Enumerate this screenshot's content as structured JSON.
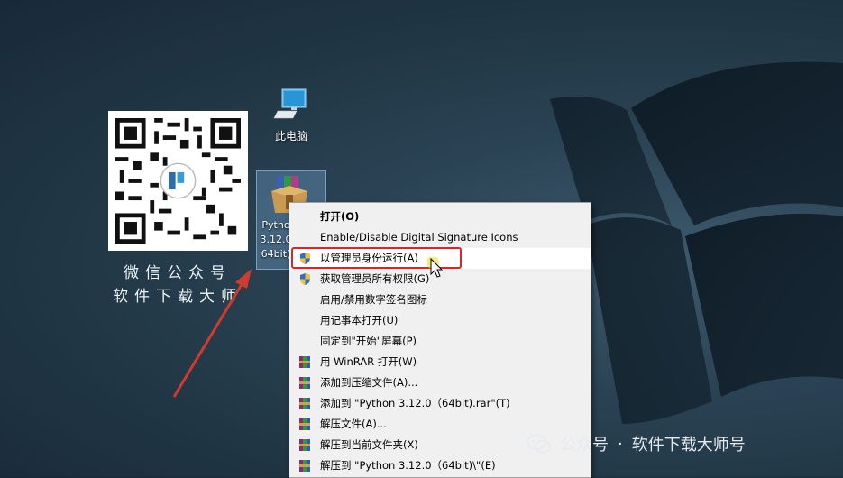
{
  "desktop": {
    "qr_caption_line1": "微信公众号",
    "qr_caption_line2": "软件下载大师",
    "this_pc_label": "此电脑",
    "rar_label_line1": "Pytho",
    "rar_label_line2": "3.12.0",
    "rar_label_line3": "64bit)",
    "watermark_prefix": "公众号",
    "watermark_sep": "·",
    "watermark_name": "软件下载大师号"
  },
  "context_menu": {
    "items": [
      {
        "label": "打开(O)",
        "icon": "none"
      },
      {
        "label": "Enable/Disable Digital Signature Icons",
        "icon": "none"
      },
      {
        "label": "以管理员身份运行(A)",
        "icon": "uac-shield-icon"
      },
      {
        "label": "获取管理员所有权限(G)",
        "icon": "uac-shield-icon"
      },
      {
        "label": "启用/禁用数字签名图标",
        "icon": "none"
      },
      {
        "label": "用记事本打开(U)",
        "icon": "none"
      },
      {
        "label": "固定到\"开始\"屏幕(P)",
        "icon": "none"
      },
      {
        "label": "用 WinRAR 打开(W)",
        "icon": "winrar-icon"
      },
      {
        "label": "添加到压缩文件(A)...",
        "icon": "winrar-icon"
      },
      {
        "label": "添加到 \"Python 3.12.0（64bit).rar\"(T)",
        "icon": "winrar-icon"
      },
      {
        "label": "解压文件(A)...",
        "icon": "winrar-icon"
      },
      {
        "label": "解压到当前文件夹(X)",
        "icon": "winrar-icon"
      },
      {
        "label": "解压到 \"Python 3.12.0（64bit)\\\"(E)",
        "icon": "winrar-icon"
      }
    ]
  },
  "colors": {
    "highlight_border": "#d8262b",
    "arrow": "#d23a2e",
    "menu_bg": "#f0f0f0"
  }
}
